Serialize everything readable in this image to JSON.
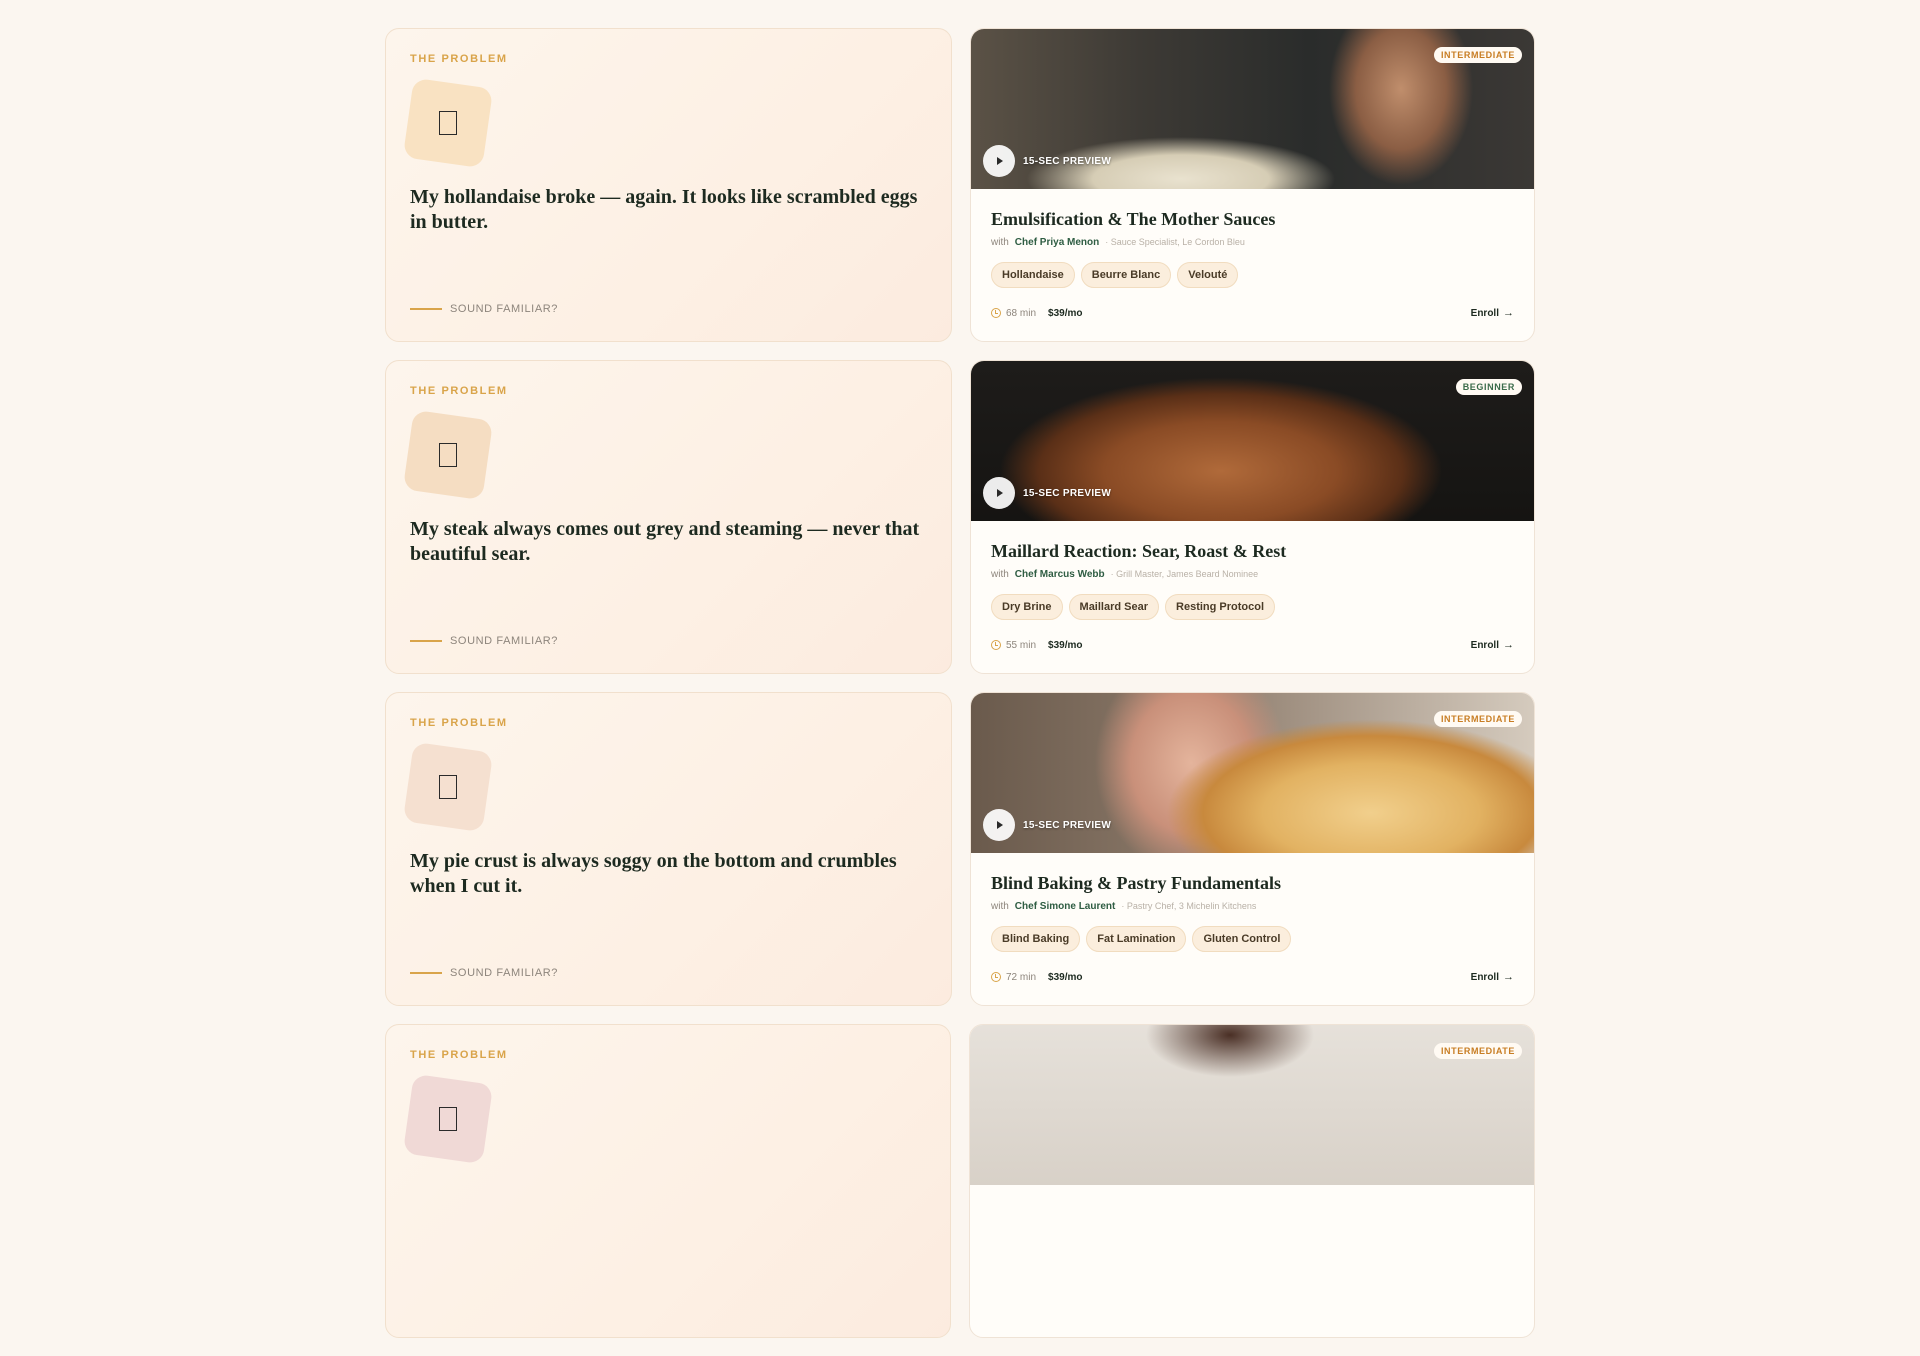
{
  "rows": [
    {
      "problem": {
        "label": "THE PROBLEM",
        "icon": "document-icon",
        "icon_bg": "#f9e2c2",
        "quote": "My hollandaise broke — again. It looks like scrambled eggs in butter.",
        "familiar": "SOUND FAMILIAR?"
      },
      "course": {
        "level": "INTERMEDIATE",
        "preview": "15-SEC PREVIEW",
        "title": "Emulsification & The Mother Sauces",
        "with": "with",
        "chef": "Chef Priya Menon",
        "role": "· Sauce Specialist, Le Cordon Bleu",
        "tags": [
          "Hollandaise",
          "Beurre Blanc",
          "Velouté"
        ],
        "duration": "68 min",
        "price": "$39/mo",
        "enroll": "Enroll"
      }
    },
    {
      "problem": {
        "label": "THE PROBLEM",
        "icon": "document-icon",
        "icon_bg": "#f5ddc2",
        "quote": "My steak always comes out grey and steaming — never that beautiful sear.",
        "familiar": "SOUND FAMILIAR?"
      },
      "course": {
        "level": "BEGINNER",
        "preview": "15-SEC PREVIEW",
        "title": "Maillard Reaction: Sear, Roast & Rest",
        "with": "with",
        "chef": "Chef Marcus Webb",
        "role": "· Grill Master, James Beard Nominee",
        "tags": [
          "Dry Brine",
          "Maillard Sear",
          "Resting Protocol"
        ],
        "duration": "55 min",
        "price": "$39/mo",
        "enroll": "Enroll"
      }
    },
    {
      "problem": {
        "label": "THE PROBLEM",
        "icon": "document-icon",
        "icon_bg": "#f5e0d0",
        "quote": "My pie crust is always soggy on the bottom and crumbles when I cut it.",
        "familiar": "SOUND FAMILIAR?"
      },
      "course": {
        "level": "INTERMEDIATE",
        "preview": "15-SEC PREVIEW",
        "title": "Blind Baking & Pastry Fundamentals",
        "with": "with",
        "chef": "Chef Simone Laurent",
        "role": "· Pastry Chef, 3 Michelin Kitchens",
        "tags": [
          "Blind Baking",
          "Fat Lamination",
          "Gluten Control"
        ],
        "duration": "72 min",
        "price": "$39/mo",
        "enroll": "Enroll"
      }
    },
    {
      "problem": {
        "label": "THE PROBLEM",
        "icon_bg": "#f0d9d6"
      },
      "course": {
        "level": "INTERMEDIATE"
      }
    }
  ]
}
